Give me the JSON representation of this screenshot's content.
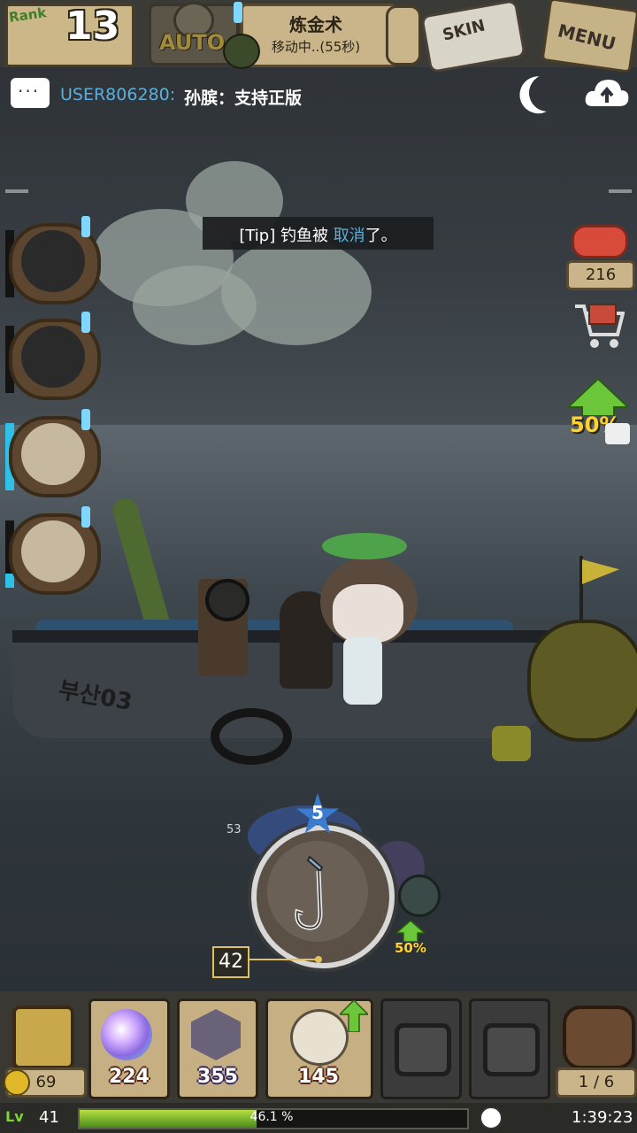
{
  "header": {
    "rank_label": "Rank",
    "rank_value": "13",
    "auto_label": "AUTO",
    "quest_title": "炼金术",
    "quest_status": "移动中..(55秒)",
    "skin_label": "SKIN",
    "menu_label": "MENU"
  },
  "chat": {
    "user": "USER806280:",
    "message": "孙膑：支持正版"
  },
  "tip": {
    "prefix": "[Tip] ",
    "text_a": "钓鱼被 ",
    "highlight": "取消",
    "text_b": "了。"
  },
  "right_panel": {
    "meat_count": "216",
    "boost_percent": "50%"
  },
  "boat": {
    "name": "부산03"
  },
  "reel": {
    "star_level": "5",
    "depth_top": "53",
    "depth_current": "42",
    "bait_boost": "50%"
  },
  "inventory": {
    "lantern_count": "69",
    "slots": [
      {
        "count": "224"
      },
      {
        "count": "355"
      },
      {
        "count": "145"
      }
    ],
    "bag_count": "1 / 6"
  },
  "status": {
    "level": "41",
    "xp_text": "46.1 %",
    "xp_fraction": 0.461,
    "time": "1:39:23"
  },
  "colors": {
    "accent_blue": "#5ab0dc",
    "gold": "#ffd42a",
    "xp_green": "#7ed23a"
  }
}
